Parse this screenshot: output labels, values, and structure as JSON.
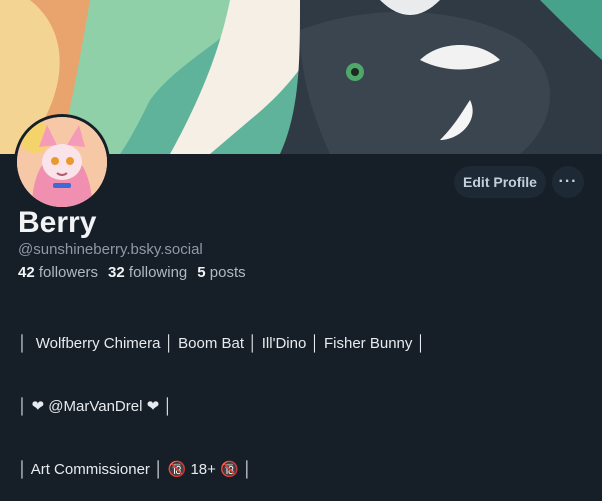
{
  "profile": {
    "name": "Berry",
    "handle": "@sunshineberry.bsky.social",
    "followers_count": "42",
    "followers_label": "followers",
    "following_count": "32",
    "following_label": "following",
    "posts_count": "5",
    "posts_label": "posts"
  },
  "actions": {
    "edit_label": "Edit Profile",
    "more_label": "···"
  },
  "bio": {
    "line1": "│  Wolfberry Chimera │ Boom Bat │ Ill'Dino │ Fisher Bunny │",
    "line2": "│ ❤ @MarVanDrel ❤ │",
    "line3": "│ Art Commissioner │ 🔞 18+ 🔞 │"
  },
  "colors": {
    "background": "#161e27",
    "button_bg": "#1e2936"
  }
}
